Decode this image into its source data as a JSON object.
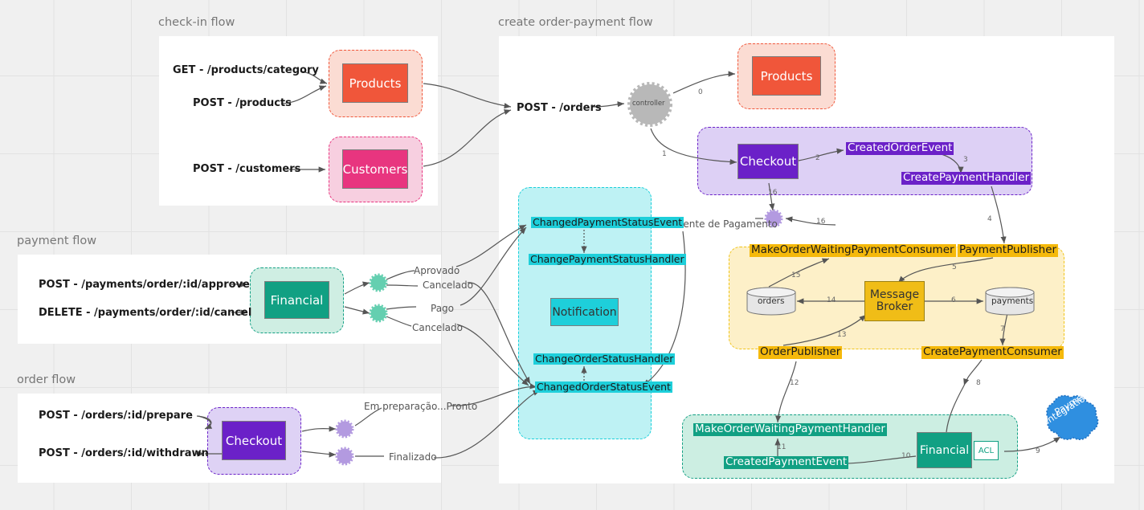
{
  "panels": [
    {
      "title": "check-in flow"
    },
    {
      "title": "create order-payment flow"
    },
    {
      "title": "payment flow"
    },
    {
      "title": "order flow"
    }
  ],
  "checkin_flow": {
    "title": "check-in flow",
    "endpoints": [
      "GET - /products/category",
      "POST - /products",
      "POST - /customers"
    ],
    "services": [
      {
        "name": "Products"
      },
      {
        "name": "Customers"
      }
    ]
  },
  "payment_flow": {
    "title": "payment flow",
    "endpoints": [
      "POST - /payments/order/:id/approve",
      "DELETE - /payments/order/:id/cancel"
    ],
    "services": [
      {
        "name": "Financial"
      }
    ],
    "status_labels": [
      "Aprovado",
      "Cancelado",
      "Pago",
      "Cancelado"
    ]
  },
  "order_flow": {
    "title": "order flow",
    "endpoints": [
      "POST - /orders/:id/prepare",
      "POST - /orders/:id/withdrawn"
    ],
    "services": [
      {
        "name": "Checkout"
      }
    ],
    "status_labels": [
      "Em preparação...Pronto",
      "Finalizado"
    ]
  },
  "create_order_payment_flow": {
    "title": "create order-payment flow",
    "entry_endpoint": "POST - /orders",
    "controller": "controller",
    "products_service": "Products",
    "checkout_group": {
      "service": "Checkout",
      "tags": [
        "CreatedOrderEvent",
        "CreatePaymentHandler"
      ]
    },
    "pending_label": "Pendente de Pagamento",
    "message_broker_group": {
      "consumers_publishers": [
        "MakeOrderWaitingPaymentConsumer",
        "PaymentPublisher",
        "OrderPublisher",
        "CreatePaymentConsumer"
      ],
      "broker": "Message Broker",
      "databases": [
        "orders",
        "payments"
      ]
    },
    "financial_group": {
      "service": "Financial",
      "acl": "ACL",
      "tags": [
        "MakeOrderWaitingPaymentHandler",
        "CreatedPaymentEvent"
      ]
    },
    "external": {
      "name": "Payment\nIntegration",
      "line1": "Payment",
      "line2": "Integration"
    },
    "edge_numbers": [
      "0",
      "1",
      "2",
      "3",
      "4",
      "5",
      "6",
      "7",
      "8",
      "9",
      "10",
      "11",
      "12",
      "13",
      "14",
      "15",
      "16",
      "16"
    ]
  },
  "notification_flow": {
    "service": "Notification",
    "tags": [
      "ChangedPaymentStatusEvent",
      "ChangePaymentStatusHandler",
      "ChangeOrderStatusHandler",
      "ChangedOrderStatusEvent"
    ]
  },
  "colors": {
    "background": "#f0f0f0",
    "grid": "#e2e2e2",
    "panel": "#ffffff",
    "products": "#f0563a",
    "customers": "#e8357f",
    "financial": "#11a083",
    "checkout": "#6b21c8",
    "notification": "#1ecfda",
    "broker": "#f0bd17",
    "tag_yellow": "#f5b90b",
    "cloud": "#2f8fe0",
    "edge": "#555555"
  }
}
